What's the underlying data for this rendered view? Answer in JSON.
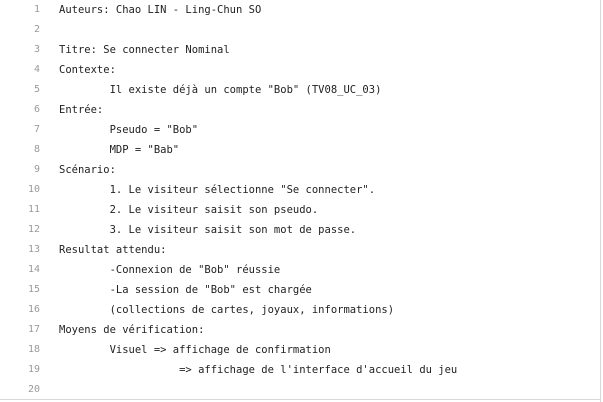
{
  "editor": {
    "lines": [
      {
        "n": "1",
        "text": "Auteurs: Chao LIN - Ling-Chun SO"
      },
      {
        "n": "2",
        "text": ""
      },
      {
        "n": "3",
        "text": "Titre: Se connecter Nominal"
      },
      {
        "n": "4",
        "text": "Contexte:"
      },
      {
        "n": "5",
        "text": "        Il existe déjà un compte \"Bob\" (TV08_UC_03)"
      },
      {
        "n": "6",
        "text": "Entrée:"
      },
      {
        "n": "7",
        "text": "        Pseudo = \"Bob\""
      },
      {
        "n": "8",
        "text": "        MDP = \"Bab\""
      },
      {
        "n": "9",
        "text": "Scénario:"
      },
      {
        "n": "10",
        "text": "        1. Le visiteur sélectionne \"Se connecter\"."
      },
      {
        "n": "11",
        "text": "        2. Le visiteur saisit son pseudo."
      },
      {
        "n": "12",
        "text": "        3. Le visiteur saisit son mot de passe."
      },
      {
        "n": "13",
        "text": "Resultat attendu:"
      },
      {
        "n": "14",
        "text": "        -Connexion de \"Bob\" réussie"
      },
      {
        "n": "15",
        "text": "        -La session de \"Bob\" est chargée"
      },
      {
        "n": "16",
        "text": "        (collections de cartes, joyaux, informations)"
      },
      {
        "n": "17",
        "text": "Moyens de vérification:"
      },
      {
        "n": "18",
        "text": "        Visuel => affichage de confirmation"
      },
      {
        "n": "19",
        "text": "                   => affichage de l'interface d'accueil du jeu"
      },
      {
        "n": "20",
        "text": ""
      }
    ]
  }
}
